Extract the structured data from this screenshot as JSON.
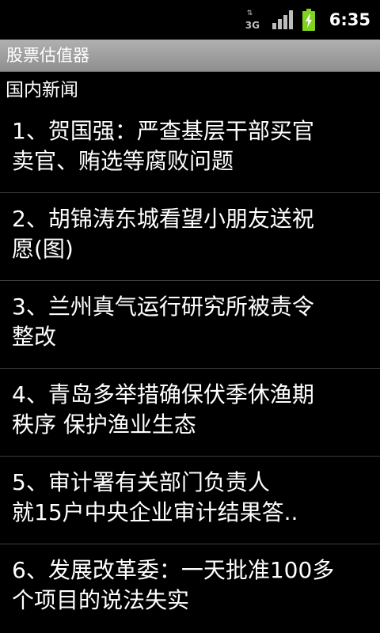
{
  "status_bar": {
    "network_type": "3G",
    "time": "6:35",
    "icons": [
      "data-arrows-icon",
      "signal-strength-icon",
      "battery-charging-icon"
    ],
    "colors": {
      "battery": "#7fd320",
      "icons": "#bdbdbd"
    }
  },
  "app": {
    "title": "股票估值器"
  },
  "section": {
    "header": "国内新闻"
  },
  "news": [
    {
      "line1": "1、贺国强：严查基层干部买官",
      "line2": "卖官、贿选等腐败问题"
    },
    {
      "line1": "2、胡锦涛东城看望小朋友送祝",
      "line2": "愿(图)"
    },
    {
      "line1": "3、兰州真气运行研究所被责令",
      "line2": "整改"
    },
    {
      "line1": "4、青岛多举措确保伏季休渔期",
      "line2": "秩序 保护渔业生态"
    },
    {
      "line1": "5、审计署有关部门负责人",
      "line2": "就15户中央企业审计结果答.."
    },
    {
      "line1": "6、发展改革委：一天批准100多",
      "line2": "个项目的说法失实"
    }
  ]
}
